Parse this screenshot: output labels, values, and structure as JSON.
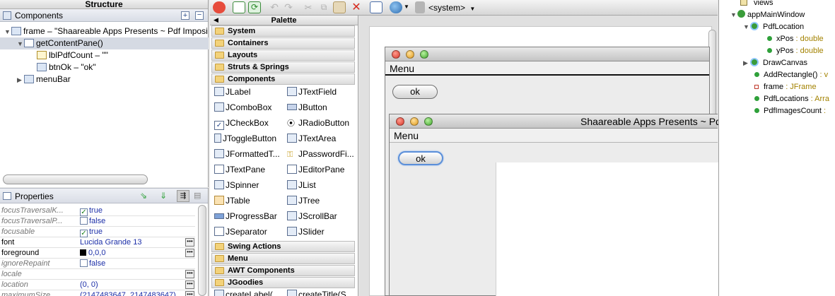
{
  "structure": {
    "title": "Structure",
    "header": "Components",
    "tree": [
      {
        "label": "frame – \"Shaareable Apps Presents ~ Pdf Imposi",
        "level": 0
      },
      {
        "label": "getContentPane()",
        "level": 1
      },
      {
        "label": "lblPdfCount – \"\"",
        "level": 2
      },
      {
        "label": "btnOk – \"ok\"",
        "level": 2
      },
      {
        "label": "menuBar",
        "level": 1
      }
    ]
  },
  "properties": {
    "title": "Properties",
    "rows": [
      {
        "name": "focusTraversalK...",
        "value": "true",
        "checked": true
      },
      {
        "name": "focusTraversalP...",
        "value": "false",
        "checked": false
      },
      {
        "name": "focusable",
        "value": "true",
        "checked": true
      },
      {
        "name": "font",
        "value": "Lucida Grande 13"
      },
      {
        "name": "foreground",
        "value": "0,0,0"
      },
      {
        "name": "ignoreRepaint",
        "value": "false",
        "checked": false
      },
      {
        "name": "locale",
        "value": ""
      },
      {
        "name": "location",
        "value": "(0, 0)"
      },
      {
        "name": "maximumSize",
        "value": "(2147483647, 2147483647)"
      }
    ]
  },
  "toolbar": {
    "system_label": "<system>"
  },
  "palette": {
    "title": "Palette",
    "categories_top": [
      "System",
      "Containers",
      "Layouts",
      "Struts & Springs",
      "Components"
    ],
    "components": [
      [
        "JLabel",
        "JTextField"
      ],
      [
        "JComboBox",
        "JButton"
      ],
      [
        "JCheckBox",
        "JRadioButton"
      ],
      [
        "JToggleButton",
        "JTextArea"
      ],
      [
        "JFormattedT...",
        "JPasswordFi..."
      ],
      [
        "JTextPane",
        "JEditorPane"
      ],
      [
        "JSpinner",
        "JList"
      ],
      [
        "JTable",
        "JTree"
      ],
      [
        "JProgressBar",
        "JScrollBar"
      ],
      [
        "JSeparator",
        "JSlider"
      ]
    ],
    "categories_bottom": [
      "Swing Actions",
      "Menu",
      "AWT Components",
      "JGoodies"
    ],
    "partial_items": [
      "createLabel(",
      "createTitle(S"
    ]
  },
  "designer": {
    "window1": {
      "menu": "Menu",
      "button": "ok"
    },
    "window2": {
      "title": "Shaareable Apps Presents ~ Pdf",
      "menu": "Menu",
      "button": "ok"
    }
  },
  "outline": {
    "rows": [
      {
        "label": "views",
        "type": ""
      },
      {
        "label": "appMainWindow",
        "type": ""
      },
      {
        "label": "PdfLocation",
        "type": ""
      },
      {
        "label": "xPos",
        "type": ": double"
      },
      {
        "label": "yPos",
        "type": ": double"
      },
      {
        "label": "DrawCanvas",
        "type": ""
      },
      {
        "label": "AddRectangle()",
        "type": ": v"
      },
      {
        "label": "frame",
        "type": ": JFrame"
      },
      {
        "label": "PdfLocations",
        "type": ": Arra"
      },
      {
        "label": "PdfImagesCount",
        "type": ": "
      }
    ]
  }
}
